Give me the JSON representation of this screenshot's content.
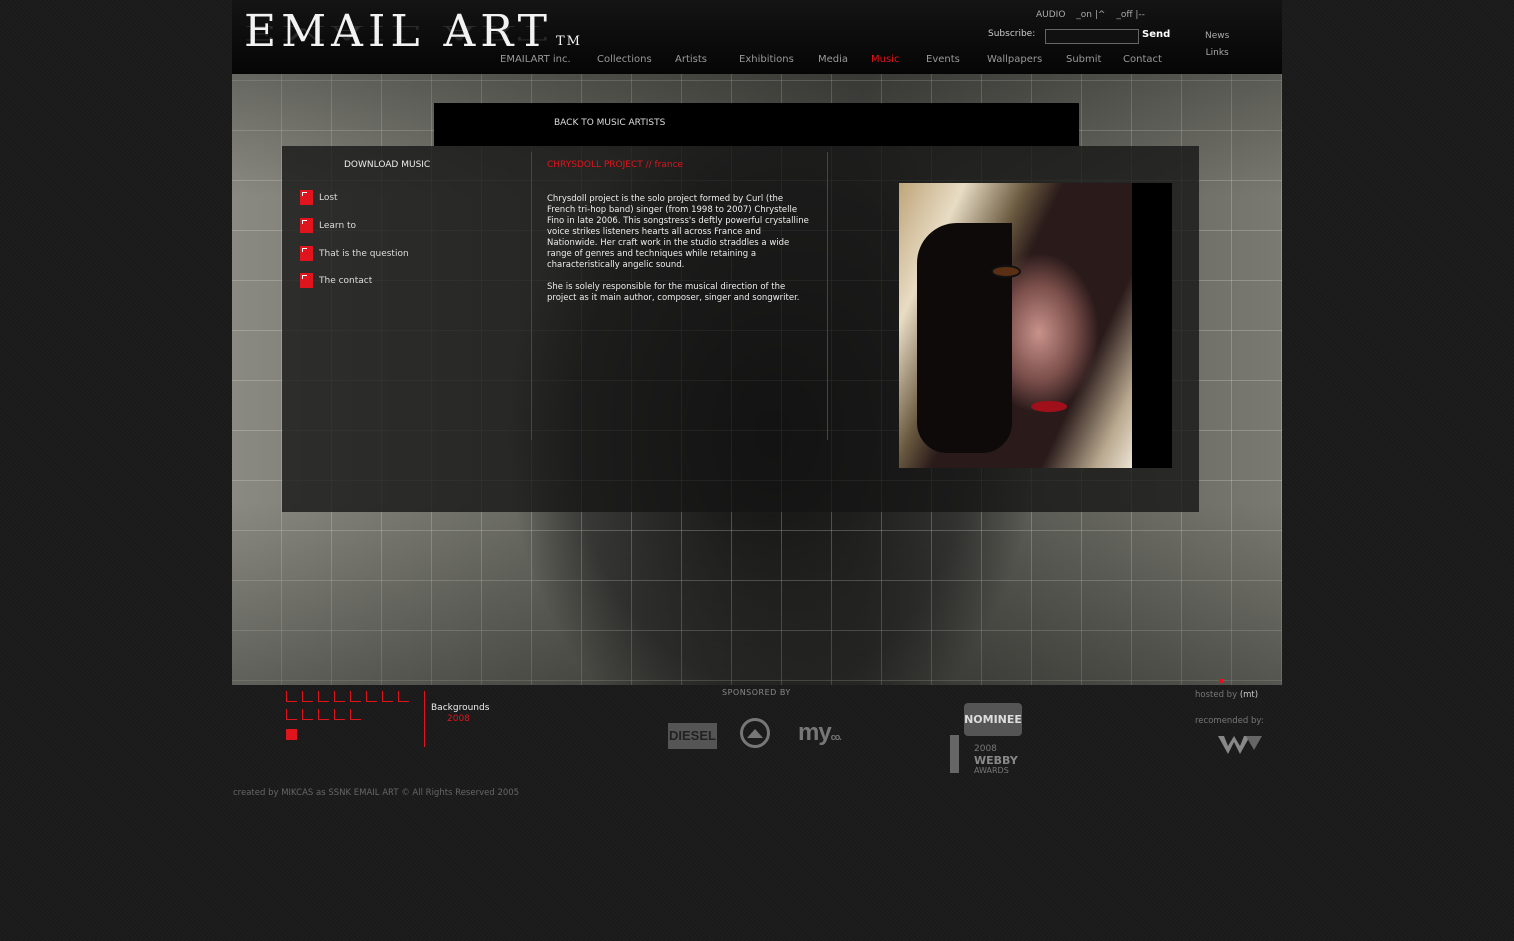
{
  "header": {
    "logo_text": "EMAIL ART",
    "logo_tm": "TM",
    "audio": {
      "label": "AUDIO",
      "on": "_on |^",
      "off": "_off |--"
    },
    "subscribe_label": "Subscribe:",
    "subscribe_value": "",
    "send_label": "Send",
    "side_links": [
      "News",
      "Links"
    ],
    "nav": [
      "EMAILART inc.",
      "Collections",
      "Artists",
      "Exhibitions",
      "Media",
      "Music",
      "Events",
      "Wallpapers",
      "Submit",
      "Contact"
    ],
    "active_nav": "Music",
    "accent_color": "#e0141c"
  },
  "back_link": "BACK TO MUSIC ARTISTS",
  "downloads": {
    "title": "DOWNLOAD MUSIC",
    "tracks": [
      "Lost",
      "Learn to",
      "That is the question",
      "The contact"
    ]
  },
  "artist": {
    "title": "CHRYSDOLL PROJECT  // france",
    "bio": [
      "Chrysdoll project is the solo project formed by Curl (the French tri-hop band) singer (from 1998 to 2007) Chrystelle Fino in late 2006. This songstress's deftly powerful crystalline voice strikes listeners hearts all across France and Nationwide. Her craft work in the studio straddles a wide range of genres and techniques while retaining a characteristically angelic sound.",
      "She is solely responsible for the musical direction of the project as it main author, composer, singer and songwriter."
    ]
  },
  "footer": {
    "backgrounds_label": "Backgrounds",
    "backgrounds_year": "2008",
    "sponsored_label": "SPONSORED BY",
    "sponsors": [
      "DIESEL",
      "my",
      "co."
    ],
    "nominee_label": "NOMINEE",
    "webby_year": "2008",
    "webby_name": "WEBBY",
    "webby_awards": "AWARDS",
    "hosted_label": "hosted by",
    "hosted_name": "(mt)",
    "recommended_label": "recomended by:",
    "credits": "created by MIKCAS as SSNK  EMAIL ART © All Rights Reserved 2005"
  }
}
